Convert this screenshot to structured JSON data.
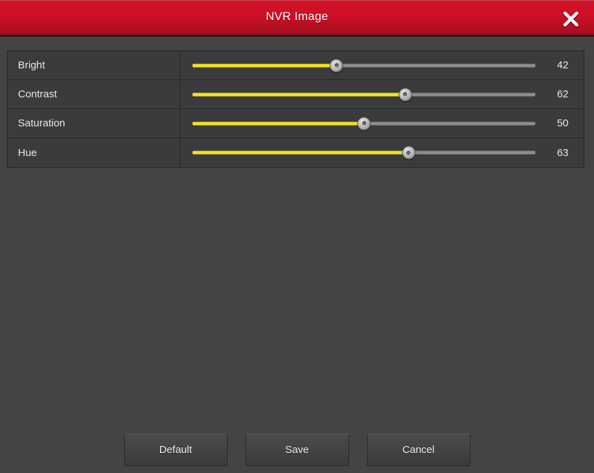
{
  "window": {
    "title": "NVR Image",
    "close_icon": "close-icon",
    "accent_color": "#cf0f27",
    "body_color": "#444446",
    "slider_fill_color": "#f2e221",
    "slider_track_color": "#8d8d8d"
  },
  "settings": [
    {
      "label": "Bright",
      "value": 42,
      "value_text": "42",
      "min": 0,
      "max": 100
    },
    {
      "label": "Contrast",
      "value": 62,
      "value_text": "62",
      "min": 0,
      "max": 100
    },
    {
      "label": "Saturation",
      "value": 50,
      "value_text": "50",
      "min": 0,
      "max": 100
    },
    {
      "label": "Hue",
      "value": 63,
      "value_text": "63",
      "min": 0,
      "max": 100
    }
  ],
  "footer": {
    "default_label": "Default",
    "save_label": "Save",
    "cancel_label": "Cancel"
  }
}
